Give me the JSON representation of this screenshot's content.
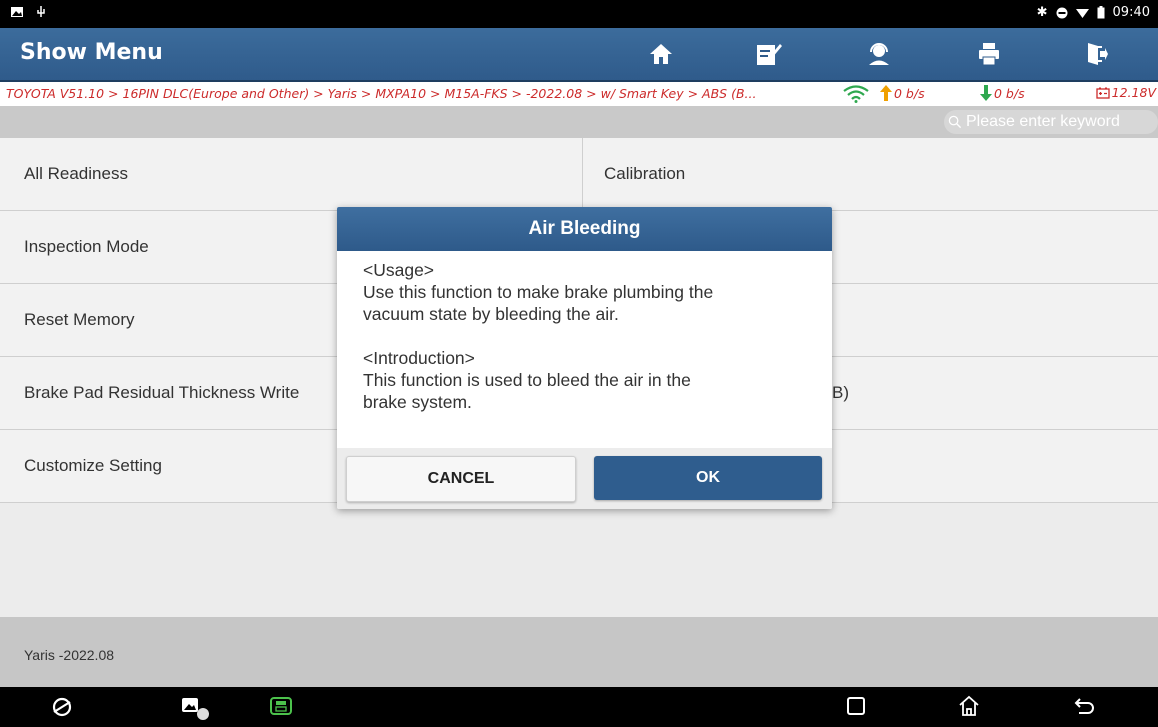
{
  "status_bar": {
    "time": "09:40"
  },
  "header": {
    "title": "Show Menu",
    "buttons": [
      "home-icon",
      "edit-icon",
      "support-icon",
      "print-icon",
      "exit-icon"
    ]
  },
  "breadcrumb": {
    "path": "TOYOTA V51.10 > 16PIN DLC(Europe and Other) > Yaris > MXPA10 > M15A-FKS > -2022.08 > w/ Smart Key > ABS (B...",
    "upload": "0 b/s",
    "download": "0 b/s",
    "voltage": "12.18V"
  },
  "search": {
    "placeholder": "Please enter keyword"
  },
  "menu": {
    "left": [
      "All Readiness",
      "Inspection Mode",
      "Reset Memory",
      "Brake Pad Residual Thickness Write",
      "Customize Setting"
    ],
    "right": [
      "Calibration",
      "",
      "",
      "B)",
      ""
    ]
  },
  "footer": {
    "vehicle": "Yaris -2022.08"
  },
  "dialog": {
    "title": "Air Bleeding",
    "usage_heading": "<Usage>",
    "usage_line1": "Use this function to make brake plumbing the",
    "usage_line2": "vacuum state by bleeding the air.",
    "intro_heading": "<Introduction>",
    "intro_line1": "This function is used to bleed the air in the",
    "intro_line2": "brake system.",
    "cancel_label": "CANCEL",
    "ok_label": "OK"
  },
  "colors": {
    "header": "#2f5b8b",
    "accent_red": "#cc2b2b",
    "ok_button": "#2f5d8e"
  }
}
